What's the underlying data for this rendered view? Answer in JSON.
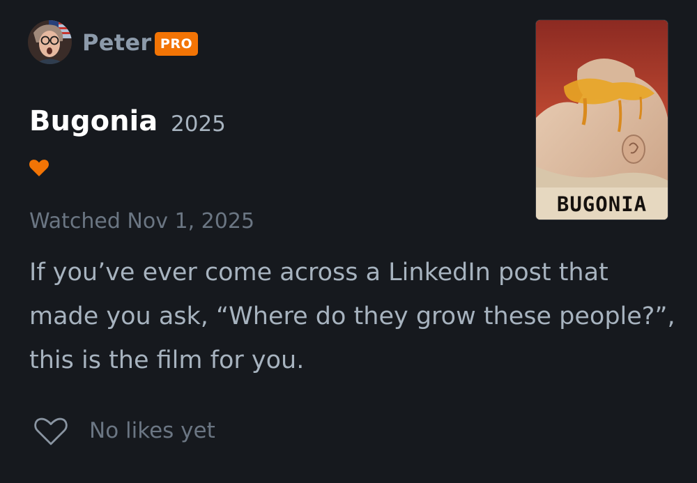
{
  "user": {
    "name": "Peter",
    "badge": "PRO",
    "avatar_icon": "avatar-photo"
  },
  "film": {
    "title": "Bugonia",
    "year": "2025",
    "liked_icon": "heart-filled-icon",
    "poster_title": "BUGONIA"
  },
  "review": {
    "watched": "Watched Nov 1, 2025",
    "text": "If you’ve ever come across a LinkedIn post that made you ask, “Where do they grow these people?”, this is the film for you."
  },
  "likes": {
    "icon": "heart-outline-icon",
    "label": "No likes yet"
  },
  "colors": {
    "background": "#16191e",
    "accent_orange": "#f27405",
    "text_muted": "#6b7683",
    "text_body": "#a7b3bf"
  }
}
